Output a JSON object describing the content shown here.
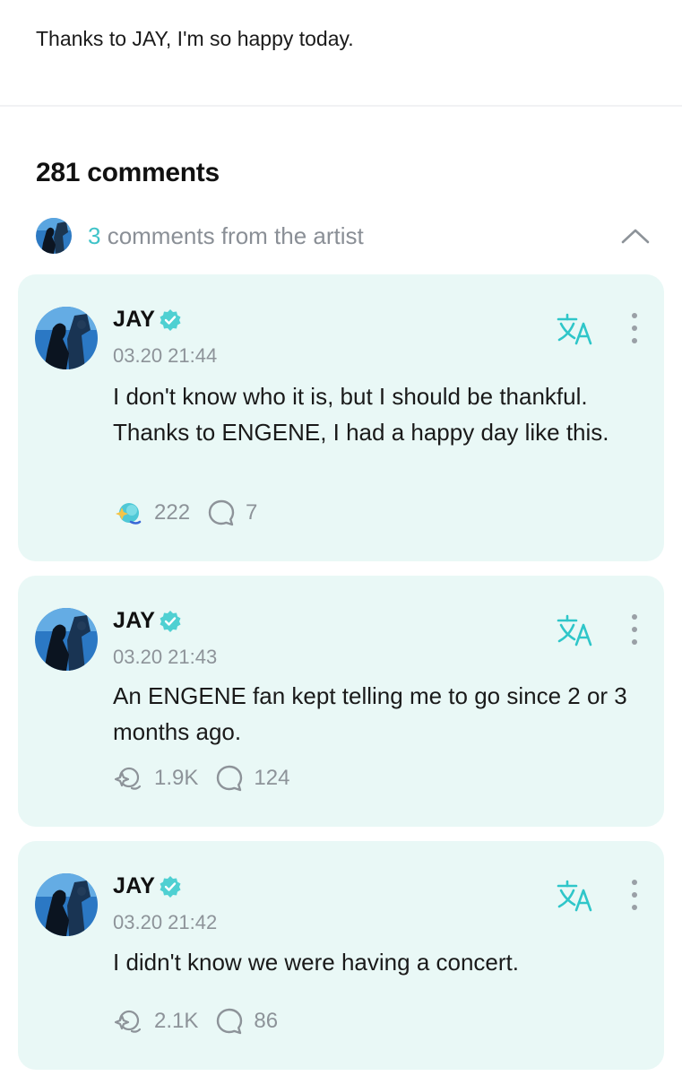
{
  "post": {
    "text": "Thanks to JAY, I'm so happy today."
  },
  "comments_header": {
    "count_label": "281 comments"
  },
  "artist_comments": {
    "count": "3",
    "label": " comments from the artist"
  },
  "colors": {
    "accent": "#3fc3c8",
    "card_background": "#e9f8f6",
    "muted_text": "#8d9399"
  },
  "comments": [
    {
      "author": "JAY",
      "timestamp": "03.20 21:44",
      "text": "I don't know who it is, but I should be thankful. Thanks to ENGENE, I had a happy day like this.",
      "likes": "222",
      "replies": "7",
      "liked": true
    },
    {
      "author": "JAY",
      "timestamp": "03.20 21:43",
      "text": "An ENGENE fan kept telling me to go since 2 or 3 months ago.",
      "likes": "1.9K",
      "replies": "124",
      "liked": false
    },
    {
      "author": "JAY",
      "timestamp": "03.20 21:42",
      "text": "I didn't know we were having a concert.",
      "likes": "2.1K",
      "replies": "86",
      "liked": false
    }
  ],
  "icons": {
    "verified": "verified-badge-icon",
    "translate": "translate-icon",
    "more": "more-vertical-icon",
    "like": "like-icon",
    "reply": "comment-bubble-icon",
    "collapse": "chevron-up-icon"
  }
}
